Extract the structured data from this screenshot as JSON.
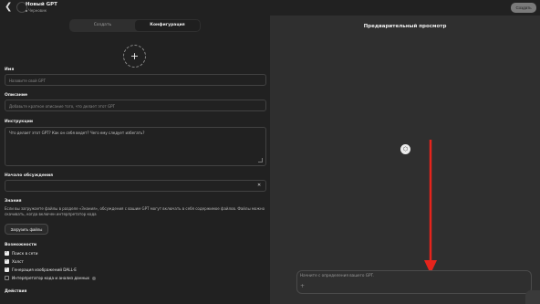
{
  "header": {
    "title": "Новый GPT",
    "status": "Черновик",
    "create_button": "Создать"
  },
  "tabs": [
    {
      "label": "Создать",
      "active": false
    },
    {
      "label": "Конфигурация",
      "active": true
    }
  ],
  "form": {
    "name_label": "Имя",
    "name_placeholder": "Назовите свой GPT",
    "description_label": "Описание",
    "description_placeholder": "Добавьте краткое описание того, что делает этот GPT",
    "instructions_label": "Инструкции",
    "instructions_placeholder": "Что делает этот GPT? Как он себя ведет? Чего ему следует избегать?",
    "conversation_starters_label": "Начало обсуждения",
    "knowledge_label": "Знания",
    "knowledge_text": "Если вы загружаете файлы в разделе «Знания», обсуждения с вашим GPT могут включать в себя содержимое файлов. Файлы можно скачивать, когда включен интерпретатор кода",
    "upload_button": "Загрузить файлы",
    "capabilities_label": "Возможности",
    "capabilities": [
      {
        "label": "Поиск в сети",
        "checked": true
      },
      {
        "label": "Холст",
        "checked": true
      },
      {
        "label": "Генерация изображений DALL·E",
        "checked": true
      },
      {
        "label": "Интерпретатор кода и анализ данных",
        "checked": false
      }
    ],
    "actions_label": "Действия"
  },
  "preview": {
    "title": "Предварительный просмотр",
    "input_placeholder": "Начните с определения вашего GPT.",
    "plus_glyph": "+"
  },
  "icons": {
    "back": "chevron-left-icon",
    "add": "plus-icon",
    "close": "close-icon",
    "cube": "cube-icon"
  },
  "colors": {
    "background": "#212121",
    "preview_panel": "#2f2f2f",
    "arrow": "#e5241c"
  }
}
